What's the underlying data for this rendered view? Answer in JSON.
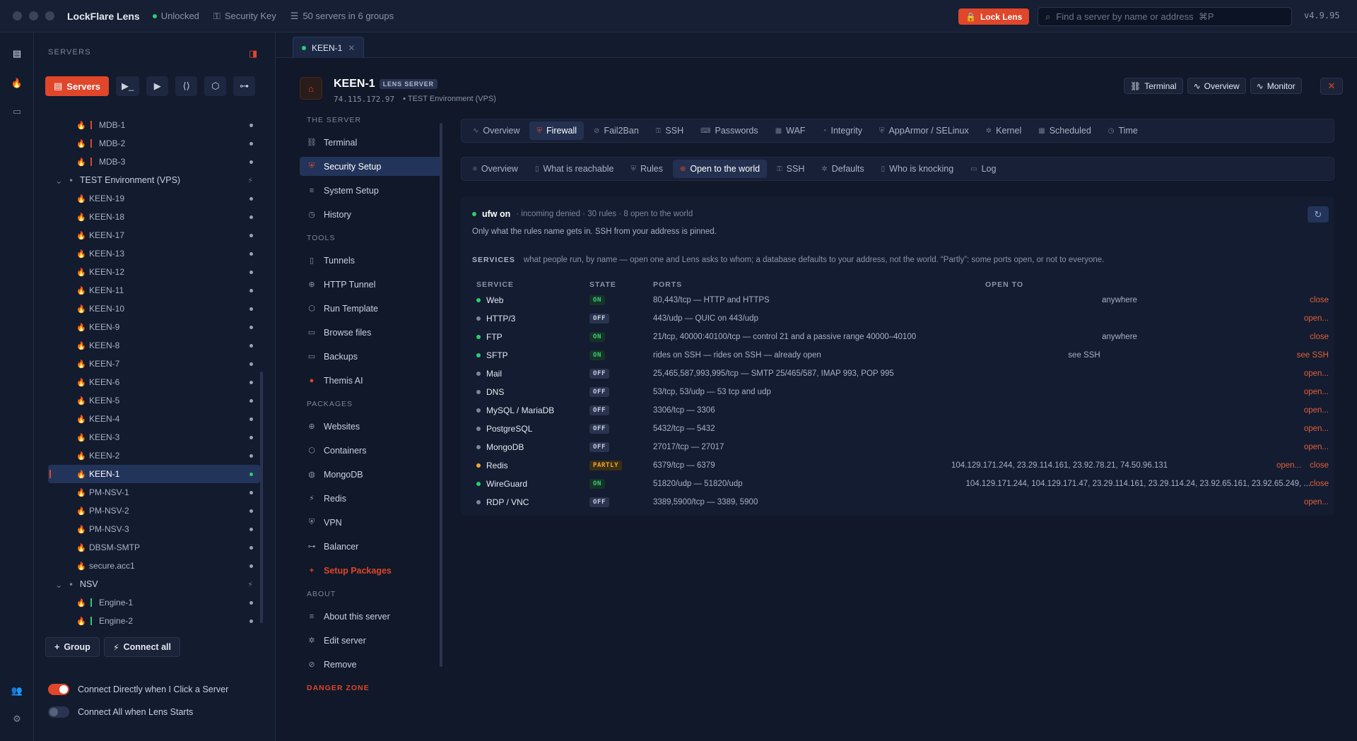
{
  "titlebar": {
    "app_name": "LockFlare Lens",
    "status": "Unlocked",
    "key": "Security Key",
    "servers": "50 servers in 6 groups",
    "lock_label": "Lock Lens",
    "search_placeholder": "Find a server by name or address  ⌘P",
    "version": "v4.9.95"
  },
  "sidebar": {
    "heading": "SERVERS",
    "tabs": [
      "Servers"
    ],
    "tree": [
      {
        "label": "MDB-1",
        "type": "server",
        "bar": "red"
      },
      {
        "label": "MDB-2",
        "type": "server",
        "bar": "red"
      },
      {
        "label": "MDB-3",
        "type": "server",
        "bar": "red"
      },
      {
        "label": "TEST Environment (VPS)",
        "type": "group"
      },
      {
        "label": "KEEN-19",
        "type": "server"
      },
      {
        "label": "KEEN-18",
        "type": "server"
      },
      {
        "label": "KEEN-17",
        "type": "server"
      },
      {
        "label": "KEEN-13",
        "type": "server"
      },
      {
        "label": "KEEN-12",
        "type": "server"
      },
      {
        "label": "KEEN-11",
        "type": "server"
      },
      {
        "label": "KEEN-10",
        "type": "server"
      },
      {
        "label": "KEEN-9",
        "type": "server"
      },
      {
        "label": "KEEN-8",
        "type": "server"
      },
      {
        "label": "KEEN-7",
        "type": "server"
      },
      {
        "label": "KEEN-6",
        "type": "server"
      },
      {
        "label": "KEEN-5",
        "type": "server"
      },
      {
        "label": "KEEN-4",
        "type": "server"
      },
      {
        "label": "KEEN-3",
        "type": "server"
      },
      {
        "label": "KEEN-2",
        "type": "server"
      },
      {
        "label": "KEEN-1",
        "type": "server",
        "active": true
      },
      {
        "label": "PM-NSV-1",
        "type": "server"
      },
      {
        "label": "PM-NSV-2",
        "type": "server"
      },
      {
        "label": "PM-NSV-3",
        "type": "server"
      },
      {
        "label": "DBSM-SMTP",
        "type": "server"
      },
      {
        "label": "secure.acc1",
        "type": "server"
      },
      {
        "label": "NSV",
        "type": "group"
      },
      {
        "label": "Engine-1",
        "type": "server",
        "bar": "green"
      },
      {
        "label": "Engine-2",
        "type": "server",
        "bar": "green"
      }
    ],
    "group_label": "Group",
    "connect_all_label": "Connect all",
    "toggle1": "Connect Directly when I Click a Server",
    "toggle2": "Connect All when Lens Starts"
  },
  "doc_tab": "KEEN-1",
  "server": {
    "name": "KEEN-1",
    "badge": "LENS SERVER",
    "ip": "74.115.172.97",
    "group": "TEST Environment (VPS)",
    "actions": [
      "Terminal",
      "Overview",
      "Monitor"
    ]
  },
  "subnav": {
    "sec1": "THE SERVER",
    "items1": [
      "Terminal",
      "Security Setup",
      "System Setup",
      "History"
    ],
    "sec2": "TOOLS",
    "items2": [
      "Tunnels",
      "HTTP Tunnel",
      "Run Template",
      "Browse files",
      "Backups",
      "Themis AI"
    ],
    "sec3": "PACKAGES",
    "items3": [
      "Websites",
      "Containers",
      "MongoDB",
      "Redis",
      "VPN",
      "Balancer",
      "Setup Packages"
    ],
    "sec4": "ABOUT",
    "items4": [
      "About this server",
      "Edit server",
      "Remove"
    ],
    "danger": "DANGER ZONE"
  },
  "tabs1": [
    "Overview",
    "Firewall",
    "Fail2Ban",
    "SSH",
    "Passwords",
    "WAF",
    "Integrity",
    "AppArmor / SELinux",
    "Kernel",
    "Scheduled",
    "Time"
  ],
  "tabs2": [
    "Overview",
    "What is reachable",
    "Rules",
    "Open to the world",
    "SSH",
    "Defaults",
    "Who is knocking",
    "Log"
  ],
  "panel": {
    "status": "ufw on",
    "summary": "· incoming denied · 30 rules · 8 open to the world",
    "note": "Only what the rules name gets in. SSH from your address is pinned.",
    "services_label": "SERVICES",
    "services_desc": "what people run, by name — open one and Lens asks to whom; a database defaults to your address, not the world. “Partly”: some ports open, or not to everyone.",
    "columns": [
      "SERVICE",
      "STATE",
      "PORTS",
      "OPEN TO"
    ],
    "rows": [
      {
        "name": "Web",
        "state": "ON",
        "ports": "80,443/tcp — HTTP and HTTPS",
        "open_to": "anywhere",
        "actions": [
          "close"
        ]
      },
      {
        "name": "HTTP/3",
        "state": "OFF",
        "ports": "443/udp — QUIC on 443/udp",
        "open_to": "",
        "actions": [
          "open..."
        ]
      },
      {
        "name": "FTP",
        "state": "ON",
        "ports": "21/tcp, 40000:40100/tcp — control 21 and a passive range 40000–40100",
        "open_to": "anywhere",
        "actions": [
          "close"
        ]
      },
      {
        "name": "SFTP",
        "state": "ON",
        "ports": "rides on SSH — rides on SSH — already open",
        "open_to": "see SSH",
        "actions": [
          "see SSH"
        ]
      },
      {
        "name": "Mail",
        "state": "OFF",
        "ports": "25,465,587,993,995/tcp — SMTP 25/465/587, IMAP 993, POP 995",
        "open_to": "",
        "actions": [
          "open..."
        ]
      },
      {
        "name": "DNS",
        "state": "OFF",
        "ports": "53/tcp, 53/udp — 53 tcp and udp",
        "open_to": "",
        "actions": [
          "open..."
        ]
      },
      {
        "name": "MySQL / MariaDB",
        "state": "OFF",
        "ports": "3306/tcp — 3306",
        "open_to": "",
        "actions": [
          "open..."
        ]
      },
      {
        "name": "PostgreSQL",
        "state": "OFF",
        "ports": "5432/tcp — 5432",
        "open_to": "",
        "actions": [
          "open..."
        ]
      },
      {
        "name": "MongoDB",
        "state": "OFF",
        "ports": "27017/tcp — 27017",
        "open_to": "",
        "actions": [
          "open..."
        ]
      },
      {
        "name": "Redis",
        "state": "PARTLY",
        "ports": "6379/tcp — 6379",
        "open_to": "104.129.171.244, 23.29.114.161, 23.92.78.21, 74.50.96.131",
        "actions": [
          "open...",
          "close"
        ]
      },
      {
        "name": "WireGuard",
        "state": "ON",
        "ports": "51820/udp — 51820/udp",
        "open_to": "104.129.171.244, 104.129.171.47, 23.29.114.161, 23.29.114.24, 23.92.65.161, 23.92.65.249, ...",
        "actions": [
          "close"
        ]
      },
      {
        "name": "RDP / VNC",
        "state": "OFF",
        "ports": "3389,5900/tcp — 3389, 5900",
        "open_to": "",
        "actions": [
          "open..."
        ]
      }
    ]
  },
  "colors": {
    "accent": "#e0462a",
    "on": "#2ecc71",
    "partly": "#f0a630",
    "off": "#7d879c"
  }
}
